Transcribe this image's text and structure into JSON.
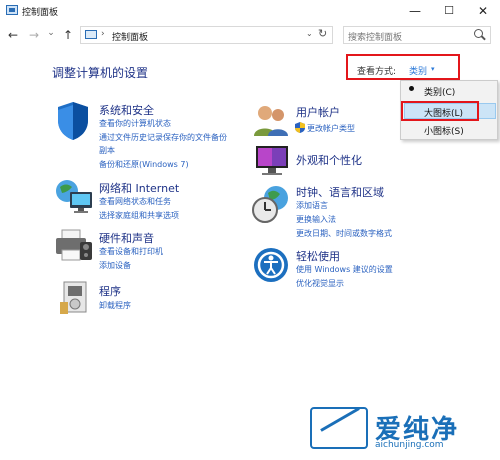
{
  "window": {
    "title": "控制面板",
    "minimize_glyph": "—",
    "maximize_glyph": "☐",
    "close_glyph": "✕"
  },
  "nav": {
    "back": "←",
    "forward": "→",
    "recent": "⌄",
    "up": "↑",
    "breadcrumb_sep": "›",
    "address": "控制面板",
    "address_dropdown": "⌄",
    "refresh": "↻",
    "search_placeholder": "搜索控制面板"
  },
  "heading": {
    "title": "调整计算机的设置",
    "view_by_label": "查看方式:",
    "view_by_value": "类别",
    "view_by_caret": "▾"
  },
  "view_menu": {
    "items": [
      "类别(C)",
      "大图标(L)",
      "小图标(S)"
    ],
    "selected_index": 0,
    "hovered_index": 1
  },
  "categories": [
    {
      "title": "系统和安全",
      "icon": "shield-icon",
      "links": [
        "查看你的计算机状态",
        "通过文件历史记录保存你的文件备份",
        "副本",
        "备份和还原(Windows 7)"
      ]
    },
    {
      "title": "网络和 Internet",
      "icon": "network-icon",
      "links": [
        "查看网络状态和任务",
        "选择家庭组和共享选项"
      ]
    },
    {
      "title": "硬件和声音",
      "icon": "printer-icon",
      "links": [
        "查看设备和打印机",
        "添加设备"
      ]
    },
    {
      "title": "程序",
      "icon": "programs-icon",
      "links": [
        "卸载程序"
      ]
    },
    {
      "title": "用户帐户",
      "icon": "users-icon",
      "links": [
        "更改帐户类型"
      ]
    },
    {
      "title": "外观和个性化",
      "icon": "appearance-icon",
      "links": []
    },
    {
      "title": "时钟、语言和区域",
      "icon": "clock-globe-icon",
      "links": [
        "添加语言",
        "更换输入法",
        "更改日期、时间或数字格式"
      ]
    },
    {
      "title": "轻松使用",
      "icon": "ease-of-access-icon",
      "links": [
        "使用 Windows 建议的设置",
        "优化视觉显示"
      ]
    }
  ],
  "watermark": {
    "brand": "爱纯净",
    "url": "aichunjing.com"
  },
  "colors": {
    "link": "#2b62c0",
    "category_title": "#1e3287",
    "highlight_red": "#e3161b",
    "menu_hover": "#cce4f7"
  }
}
